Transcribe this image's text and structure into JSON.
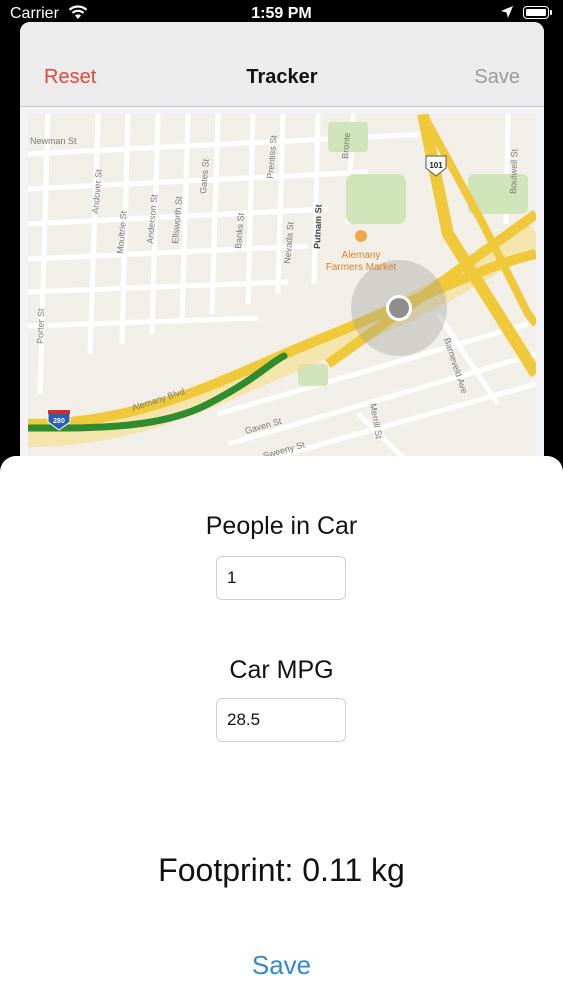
{
  "status_bar": {
    "carrier": "Carrier",
    "time": "1:59 PM"
  },
  "navbar": {
    "reset_label": "Reset",
    "title": "Tracker",
    "save_label": "Save"
  },
  "map": {
    "streets": [
      "Newman St",
      "Andover St",
      "Moultrie St",
      "Anderson St",
      "Ellsworth St",
      "Gates St",
      "Banks St",
      "Prentiss St",
      "Nevada St",
      "Putnam St",
      "Bronte",
      "Boutwell St",
      "Porter St",
      "Alemany Blvd",
      "Gaven St",
      "Sweeny St",
      "Merrill St",
      "Barneveld Ave"
    ],
    "poi": [
      "Alemany",
      "Farmers Market"
    ],
    "shields": [
      "101",
      "280"
    ]
  },
  "form": {
    "people_label": "People in Car",
    "people_value": "1",
    "mpg_label": "Car MPG",
    "mpg_value": "28.5"
  },
  "result": {
    "footprint": "Footprint: 0.11 kg"
  },
  "actions": {
    "save_label": "Save"
  },
  "colors": {
    "reset": "#e5453a",
    "save": "#2f89d8",
    "route": "#2e8b2e",
    "highway": "#f0c93a"
  }
}
